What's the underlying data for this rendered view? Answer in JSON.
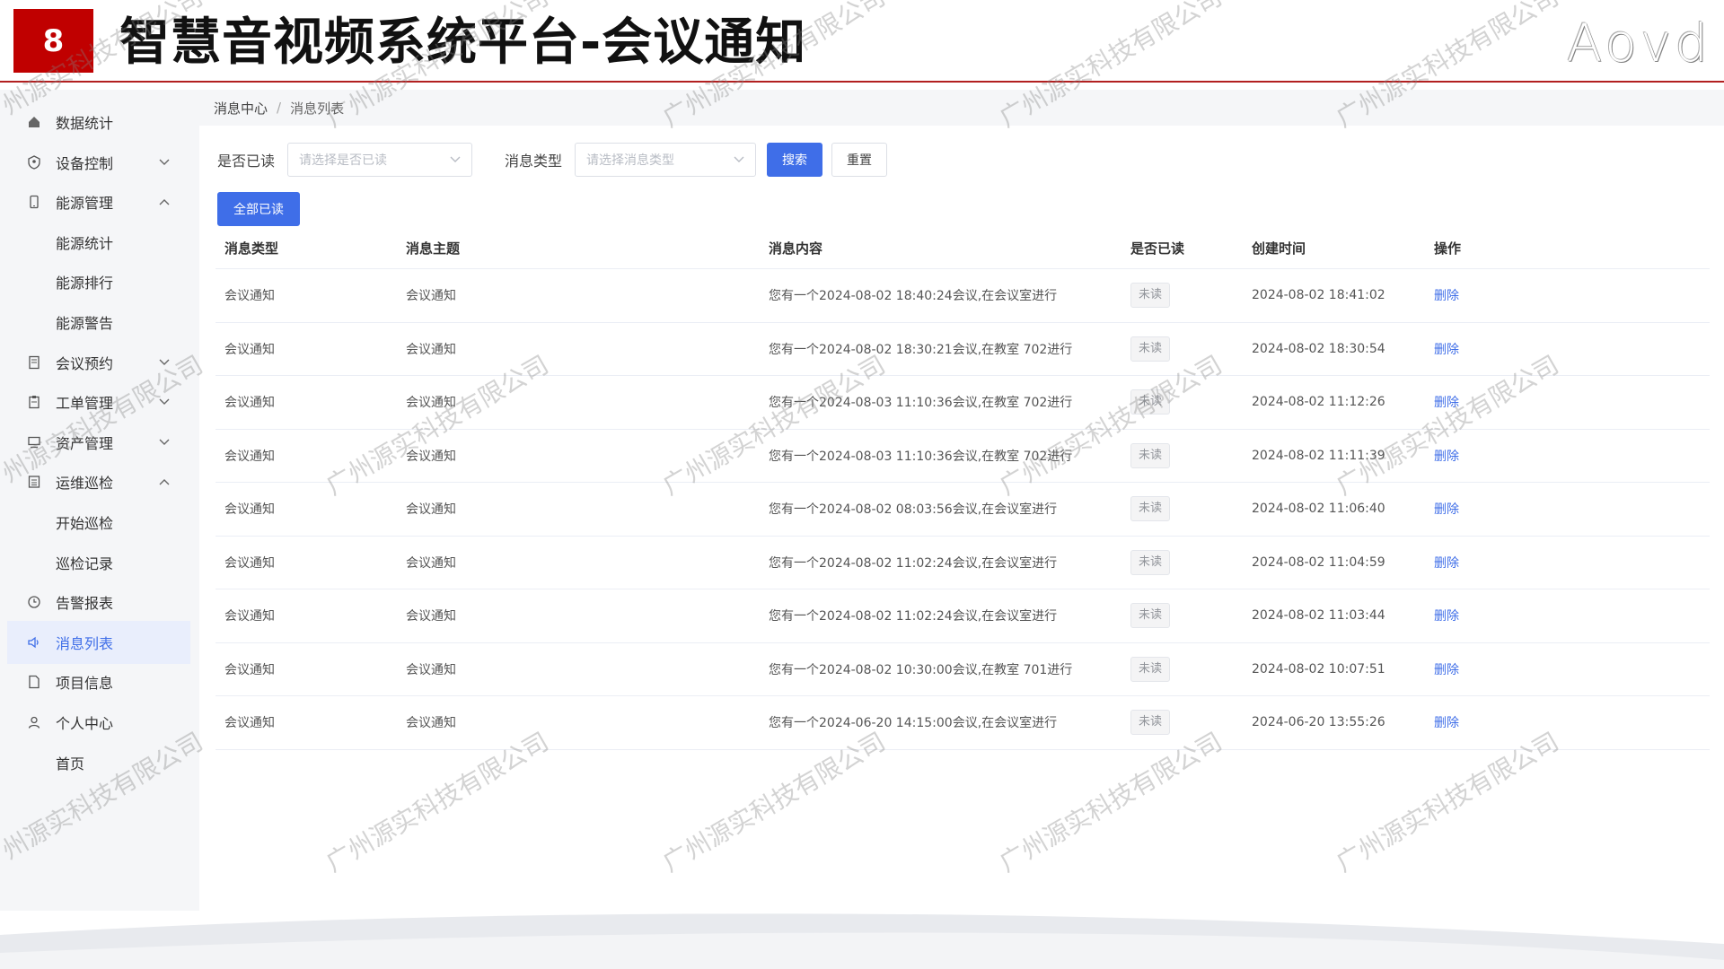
{
  "slide": {
    "badge": "8",
    "title": "智慧音视频系统平台-会议通知",
    "logo": "Aovd"
  },
  "sidebar": {
    "items": [
      {
        "label": "数据统计",
        "icon": "home-icon"
      },
      {
        "label": "设备控制",
        "icon": "shield-icon",
        "arrow": "⌄"
      },
      {
        "label": "能源管理",
        "icon": "phone-icon",
        "arrow": "⌃"
      },
      {
        "label": "能源统计",
        "sub": true
      },
      {
        "label": "能源排行",
        "sub": true
      },
      {
        "label": "能源警告",
        "sub": true
      },
      {
        "label": "会议预约",
        "icon": "document-icon",
        "arrow": "⌄"
      },
      {
        "label": "工单管理",
        "icon": "clipboard-icon",
        "arrow": "⌄"
      },
      {
        "label": "资产管理",
        "icon": "monitor-icon",
        "arrow": "⌄"
      },
      {
        "label": "运维巡检",
        "icon": "list-icon",
        "arrow": "⌃"
      },
      {
        "label": "开始巡检",
        "sub": true
      },
      {
        "label": "巡检记录",
        "sub": true
      },
      {
        "label": "告警报表",
        "icon": "clock-icon"
      },
      {
        "label": "消息列表",
        "icon": "speaker-icon",
        "active": true
      },
      {
        "label": "项目信息",
        "icon": "file-icon"
      },
      {
        "label": "个人中心",
        "icon": "user-icon"
      },
      {
        "label": "首页",
        "sub": true
      }
    ]
  },
  "breadcrumb": {
    "root": "消息中心",
    "separator": "/",
    "current": "消息列表"
  },
  "filters": {
    "read_label": "是否已读",
    "read_placeholder": "请选择是否已读",
    "type_label": "消息类型",
    "type_placeholder": "请选择消息类型",
    "search_btn": "搜索",
    "reset_btn": "重置",
    "read_all_btn": "全部已读"
  },
  "table": {
    "headers": [
      "消息类型",
      "消息主题",
      "消息内容",
      "是否已读",
      "创建时间",
      "操作"
    ],
    "rows": [
      {
        "type": "会议通知",
        "subject": "会议通知",
        "content": "您有一个2024-08-02 18:40:24会议,在会议室进行",
        "read": "未读",
        "created": "2024-08-02 18:41:02",
        "action": "删除"
      },
      {
        "type": "会议通知",
        "subject": "会议通知",
        "content": "您有一个2024-08-02 18:30:21会议,在教室 702进行",
        "read": "未读",
        "created": "2024-08-02 18:30:54",
        "action": "删除"
      },
      {
        "type": "会议通知",
        "subject": "会议通知",
        "content": "您有一个2024-08-03 11:10:36会议,在教室 702进行",
        "read": "未读",
        "created": "2024-08-02 11:12:26",
        "action": "删除"
      },
      {
        "type": "会议通知",
        "subject": "会议通知",
        "content": "您有一个2024-08-03 11:10:36会议,在教室 702进行",
        "read": "未读",
        "created": "2024-08-02 11:11:39",
        "action": "删除"
      },
      {
        "type": "会议通知",
        "subject": "会议通知",
        "content": "您有一个2024-08-02 08:03:56会议,在会议室进行",
        "read": "未读",
        "created": "2024-08-02 11:06:40",
        "action": "删除"
      },
      {
        "type": "会议通知",
        "subject": "会议通知",
        "content": "您有一个2024-08-02 11:02:24会议,在会议室进行",
        "read": "未读",
        "created": "2024-08-02 11:04:59",
        "action": "删除"
      },
      {
        "type": "会议通知",
        "subject": "会议通知",
        "content": "您有一个2024-08-02 11:02:24会议,在会议室进行",
        "read": "未读",
        "created": "2024-08-02 11:03:44",
        "action": "删除"
      },
      {
        "type": "会议通知",
        "subject": "会议通知",
        "content": "您有一个2024-08-02 10:30:00会议,在教室 701进行",
        "read": "未读",
        "created": "2024-08-02 10:07:51",
        "action": "删除"
      },
      {
        "type": "会议通知",
        "subject": "会议通知",
        "content": "您有一个2024-06-20 14:15:00会议,在会议室进行",
        "read": "未读",
        "created": "2024-06-20 13:55:26",
        "action": "删除"
      }
    ]
  },
  "watermark": "广州源实科技有限公司",
  "colors": {
    "accent": "#3f6ee8",
    "brand_red": "#c00000",
    "sidebar_bg": "#f5f6f8",
    "active_bg": "#e9eefc"
  }
}
